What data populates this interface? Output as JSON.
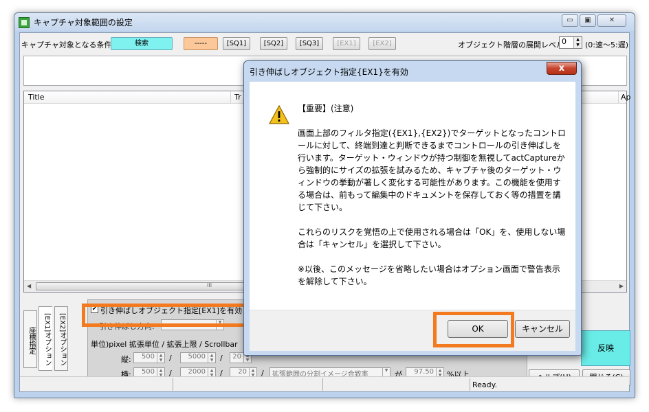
{
  "window": {
    "title": "キャプチャ対象範囲の設定",
    "min": "▭",
    "max": "▣",
    "close": "✕"
  },
  "toolbar": {
    "condition_label": "キャプチャ対象となる条件:",
    "search": "検索",
    "dash": "-----",
    "sq1": "[SQ1]",
    "sq2": "[SQ2]",
    "sq3": "[SQ3]",
    "ex1": "[EX1]",
    "ex2": "[EX2]",
    "level_label": "オブジェクト階層の展開レベル:",
    "level_value": "0",
    "level_note": "(0:速～5:遅)"
  },
  "list": {
    "col_title": "Title",
    "col_tr": "Tr",
    "col_ap": "Ap",
    "scroll_mark": "III"
  },
  "tabs": {
    "coord": "座標指定",
    "ex1_opt": "[EX1]オプション",
    "ex2_opt": "[EX2]オプション"
  },
  "options": {
    "stretch_checkbox": "引き伸ばしオブジェクト指定[EX1]を有効",
    "direction_label": "引き伸ばし方向:",
    "unit_row": "単位)pixel  拡張単位 / 拡張上限 / Scrollbar",
    "vert_label": "縦:",
    "horiz_label": "横:",
    "v1": "500",
    "v2": "5000",
    "v3": "20",
    "h1": "500",
    "h2": "2000",
    "h3": "20",
    "slash": "/",
    "ratio_select": "拡張範囲の分割イメージ合致率",
    "ga": "が",
    "pct": "97.50",
    "pct_suffix": "%以上"
  },
  "buttons": {
    "apply": "反映",
    "help": "ヘルプ(H)",
    "close": "閉じる(C)"
  },
  "status": {
    "text": "Ready."
  },
  "dialog": {
    "title": "引き伸ばしオブジェクト指定{EX1}を有効",
    "close": "x",
    "heading": "【重要】(注意)",
    "para1": "画面上部のフィルタ指定({EX1},{EX2})でターゲットとなったコントロールに対して、終端到達と判断できるまでコントロールの引き伸ばしを行います。ターゲット・ウィンドウが持つ制御を無視してactCaptureから強制的にサイズの拡張を試みるため、キャプチャ後のターゲット・ウィンドウの挙動が著しく変化する可能性があります。この機能を使用する場合は、前もって編集中のドキュメントを保存しておく等の措置を講じて下さい。",
    "para2": "これらのリスクを覚悟の上で使用される場合は「OK」を、使用しない場合は「キャンセル」を選択して下さい。",
    "para3": "※以後、このメッセージを省略したい場合はオプション画面で警告表示を解除して下さい。",
    "ok": "OK",
    "cancel": "キャンセル"
  },
  "colors": {
    "highlight": "#f37a1f",
    "search_bg": "#7ff2f0",
    "apply_bg": "#69ece7"
  }
}
